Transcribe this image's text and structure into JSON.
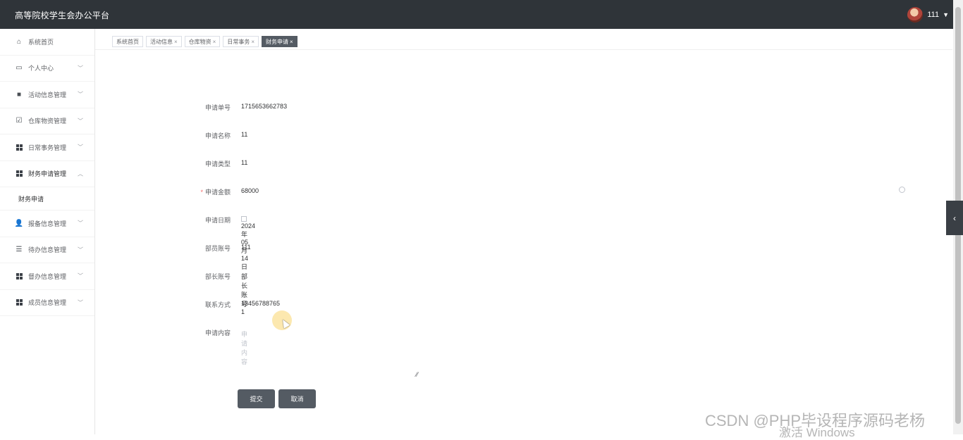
{
  "app": {
    "title": "高等院校学生会办公平台",
    "user": "111"
  },
  "sidebar": {
    "items": [
      {
        "label": "系统首页",
        "icon": "home-icon"
      },
      {
        "label": "个人中心",
        "icon": "profile-icon"
      },
      {
        "label": "活动信息管理",
        "icon": "briefcase-icon"
      },
      {
        "label": "仓库物资管理",
        "icon": "checkbox-icon"
      },
      {
        "label": "日常事务管理",
        "icon": "grid-icon"
      },
      {
        "label": "财务申请管理",
        "icon": "grid-icon"
      },
      {
        "label": "报备信息管理",
        "icon": "user-icon"
      },
      {
        "label": "待办信息管理",
        "icon": "list-icon"
      },
      {
        "label": "督办信息管理",
        "icon": "grid-icon"
      },
      {
        "label": "成员信息管理",
        "icon": "grid-icon"
      }
    ],
    "submenu": {
      "label": "财务申请"
    }
  },
  "tabs": [
    {
      "label": "系统首页",
      "closable": false
    },
    {
      "label": "活动信息",
      "closable": true
    },
    {
      "label": "仓库物资",
      "closable": true
    },
    {
      "label": "日常事务",
      "closable": true
    },
    {
      "label": "财务申请",
      "closable": true,
      "active": true
    }
  ],
  "form": {
    "fields": [
      {
        "label": "申请单号",
        "value": "1715653662783"
      },
      {
        "label": "申请名称",
        "value": "11"
      },
      {
        "label": "申请类型",
        "value": "11"
      },
      {
        "label": "申请金额",
        "value": "68000",
        "required": true
      },
      {
        "label": "申请日期",
        "value": "2024 年 05 月 14 日"
      },
      {
        "label": "部员账号",
        "value": "111"
      },
      {
        "label": "部长账号",
        "value": "部长账号1"
      },
      {
        "label": "联系方式",
        "value": "13456788765"
      },
      {
        "label": "申请内容",
        "placeholder": "申请内容"
      }
    ],
    "submit_label": "提交",
    "cancel_label": "取消"
  },
  "overlay": {
    "watermark": "CSDN @PHP毕设程序源码老杨",
    "windows": "激活 Windows"
  },
  "colors": {
    "header": "#2f3439",
    "accent": "#545b63",
    "required": "#f56c6c"
  }
}
